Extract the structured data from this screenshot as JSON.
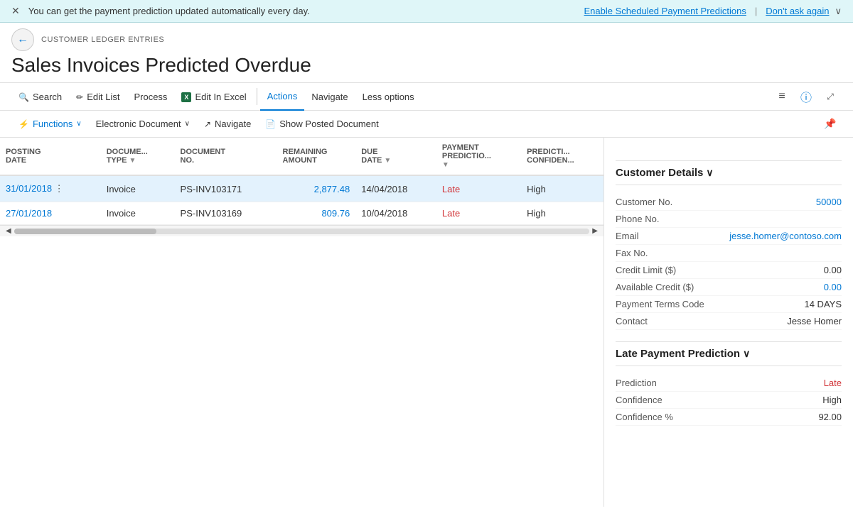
{
  "notification": {
    "message": "You can get the payment prediction updated automatically every day.",
    "link1": "Enable Scheduled Payment Predictions",
    "pipe": "|",
    "link2": "Don't ask again"
  },
  "breadcrumb": "CUSTOMER LEDGER ENTRIES",
  "page_title": "Sales Invoices Predicted Overdue",
  "toolbar1": {
    "search": "Search",
    "edit_list": "Edit List",
    "process": "Process",
    "edit_in_excel": "Edit In Excel",
    "actions": "Actions",
    "navigate": "Navigate",
    "less_options": "Less options"
  },
  "toolbar2": {
    "functions": "Functions",
    "electronic_document": "Electronic Document",
    "navigate": "Navigate",
    "show_posted_document": "Show Posted Document"
  },
  "table": {
    "columns": [
      {
        "key": "posting_date",
        "label": "POSTING DATE",
        "sortable": false
      },
      {
        "key": "document_type",
        "label": "DOCUME... TYPE",
        "sortable": true
      },
      {
        "key": "document_no",
        "label": "DOCUMENT NO.",
        "sortable": false
      },
      {
        "key": "remaining_amount",
        "label": "REMAINING AMOUNT",
        "sortable": false
      },
      {
        "key": "due_date",
        "label": "DUE DATE",
        "sortable": true
      },
      {
        "key": "payment_prediction",
        "label": "PAYMENT PREDICTIO...",
        "sortable": true
      },
      {
        "key": "prediction_confidence",
        "label": "PREDICTI... CONFIDEN...",
        "sortable": false
      }
    ],
    "rows": [
      {
        "id": 1,
        "posting_date": "31/01/2018",
        "document_type": "Invoice",
        "document_no": "PS-INV103171",
        "remaining_amount": "2,877.48",
        "due_date": "14/04/2018",
        "payment_prediction": "Late",
        "prediction_confidence": "High",
        "selected": true
      },
      {
        "id": 2,
        "posting_date": "27/01/2018",
        "document_type": "Invoice",
        "document_no": "PS-INV103169",
        "remaining_amount": "809.76",
        "due_date": "10/04/2018",
        "payment_prediction": "Late",
        "prediction_confidence": "High",
        "selected": false
      }
    ]
  },
  "customer_details": {
    "section_title": "Customer Details",
    "fields": [
      {
        "label": "Customer No.",
        "value": "50000",
        "is_link": true
      },
      {
        "label": "Phone No.",
        "value": "",
        "is_link": false
      },
      {
        "label": "Email",
        "value": "jesse.homer@contoso.com",
        "is_link": true
      },
      {
        "label": "Fax No.",
        "value": "",
        "is_link": false
      },
      {
        "label": "Credit Limit ($)",
        "value": "0.00",
        "is_link": false
      },
      {
        "label": "Available Credit ($)",
        "value": "0.00",
        "is_link": true,
        "is_teal": true
      },
      {
        "label": "Payment Terms Code",
        "value": "14 DAYS",
        "is_link": false
      },
      {
        "label": "Contact",
        "value": "Jesse Homer",
        "is_link": false
      }
    ]
  },
  "late_payment_prediction": {
    "section_title": "Late Payment Prediction",
    "fields": [
      {
        "label": "Prediction",
        "value": "Late",
        "is_prediction": true
      },
      {
        "label": "Confidence",
        "value": "High",
        "is_confidence": true
      },
      {
        "label": "Confidence %",
        "value": "92.00",
        "is_link": false
      }
    ]
  }
}
